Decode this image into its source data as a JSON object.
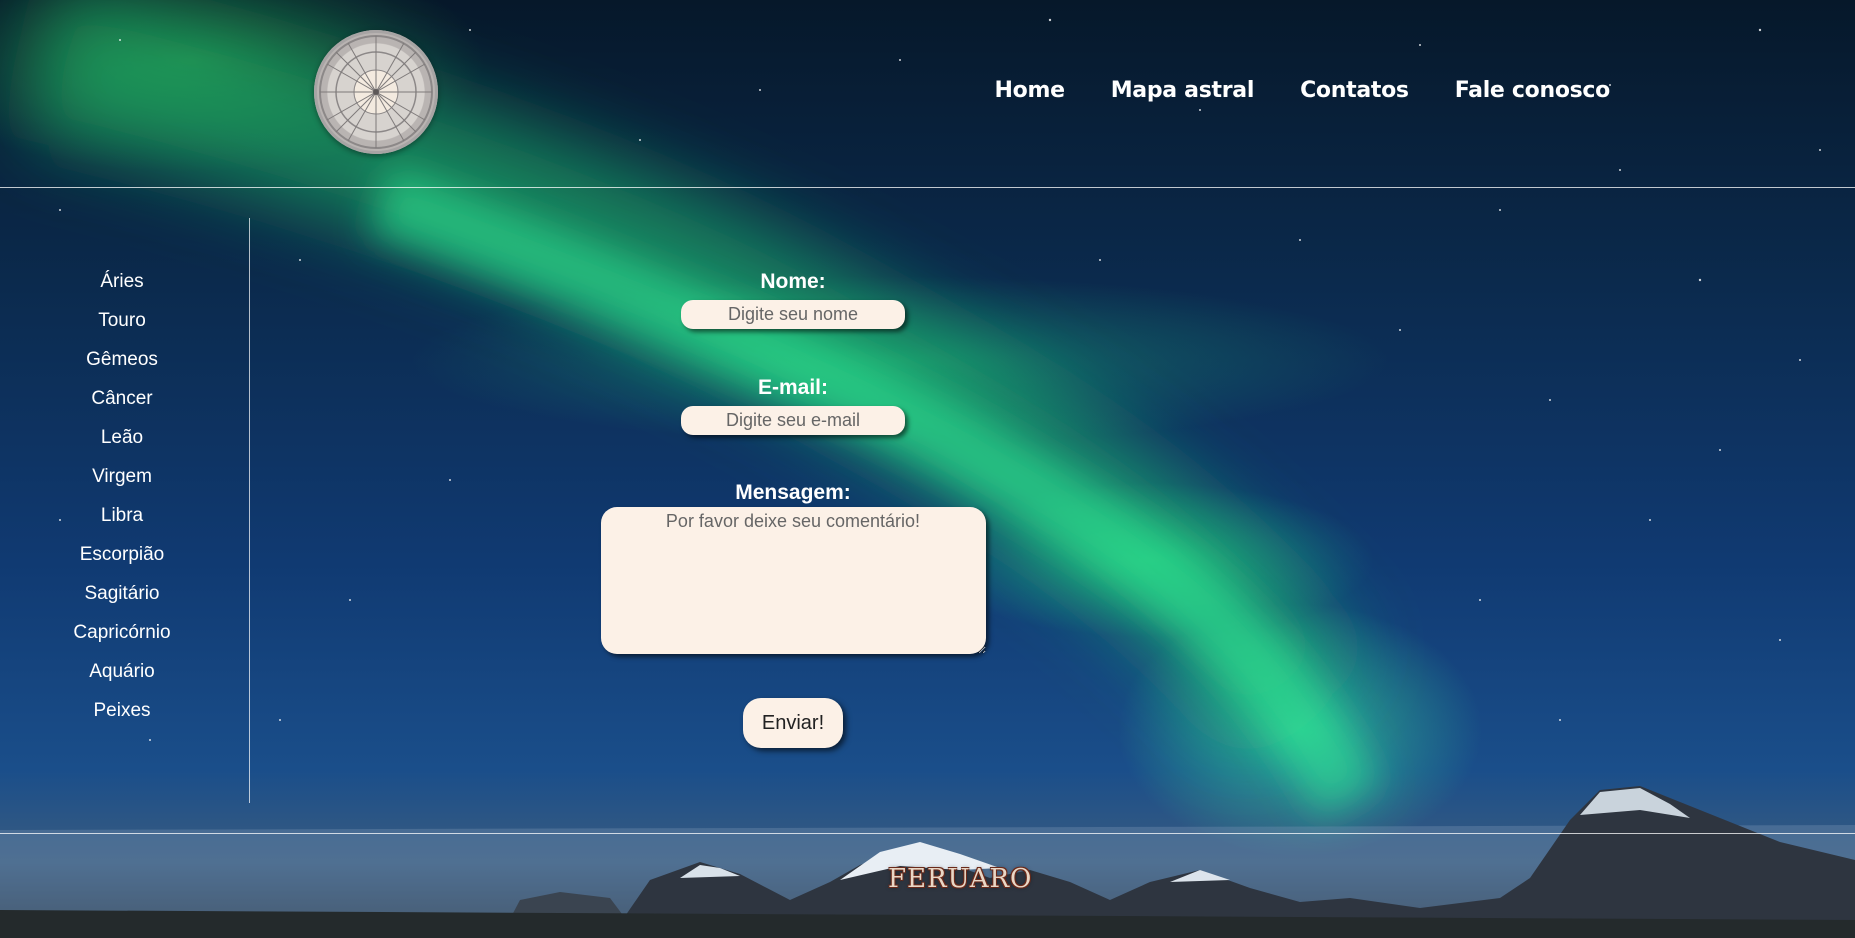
{
  "header": {
    "nav": [
      {
        "label": "Home"
      },
      {
        "label": "Mapa astral"
      },
      {
        "label": "Contatos"
      },
      {
        "label": "Fale conosco"
      }
    ]
  },
  "sidebar": {
    "items": [
      {
        "label": "Áries"
      },
      {
        "label": "Touro"
      },
      {
        "label": "Gêmeos"
      },
      {
        "label": "Câncer"
      },
      {
        "label": "Leão"
      },
      {
        "label": "Virgem"
      },
      {
        "label": "Libra"
      },
      {
        "label": "Escorpião"
      },
      {
        "label": "Sagitário"
      },
      {
        "label": "Capricórnio"
      },
      {
        "label": "Aquário"
      },
      {
        "label": "Peixes"
      }
    ]
  },
  "form": {
    "name_label": "Nome:",
    "name_placeholder": "Digite seu nome",
    "email_label": "E-mail:",
    "email_placeholder": "Digite seu e-mail",
    "message_label": "Mensagem:",
    "message_placeholder": "Por favor deixe seu comentário!",
    "submit_label": "Enviar!"
  },
  "footer": {
    "brand": "FERUARO"
  },
  "colors": {
    "field_background": "#fcf1e7",
    "text": "#ffffff"
  },
  "icons": {
    "logo": "zodiac-wheel-icon"
  }
}
